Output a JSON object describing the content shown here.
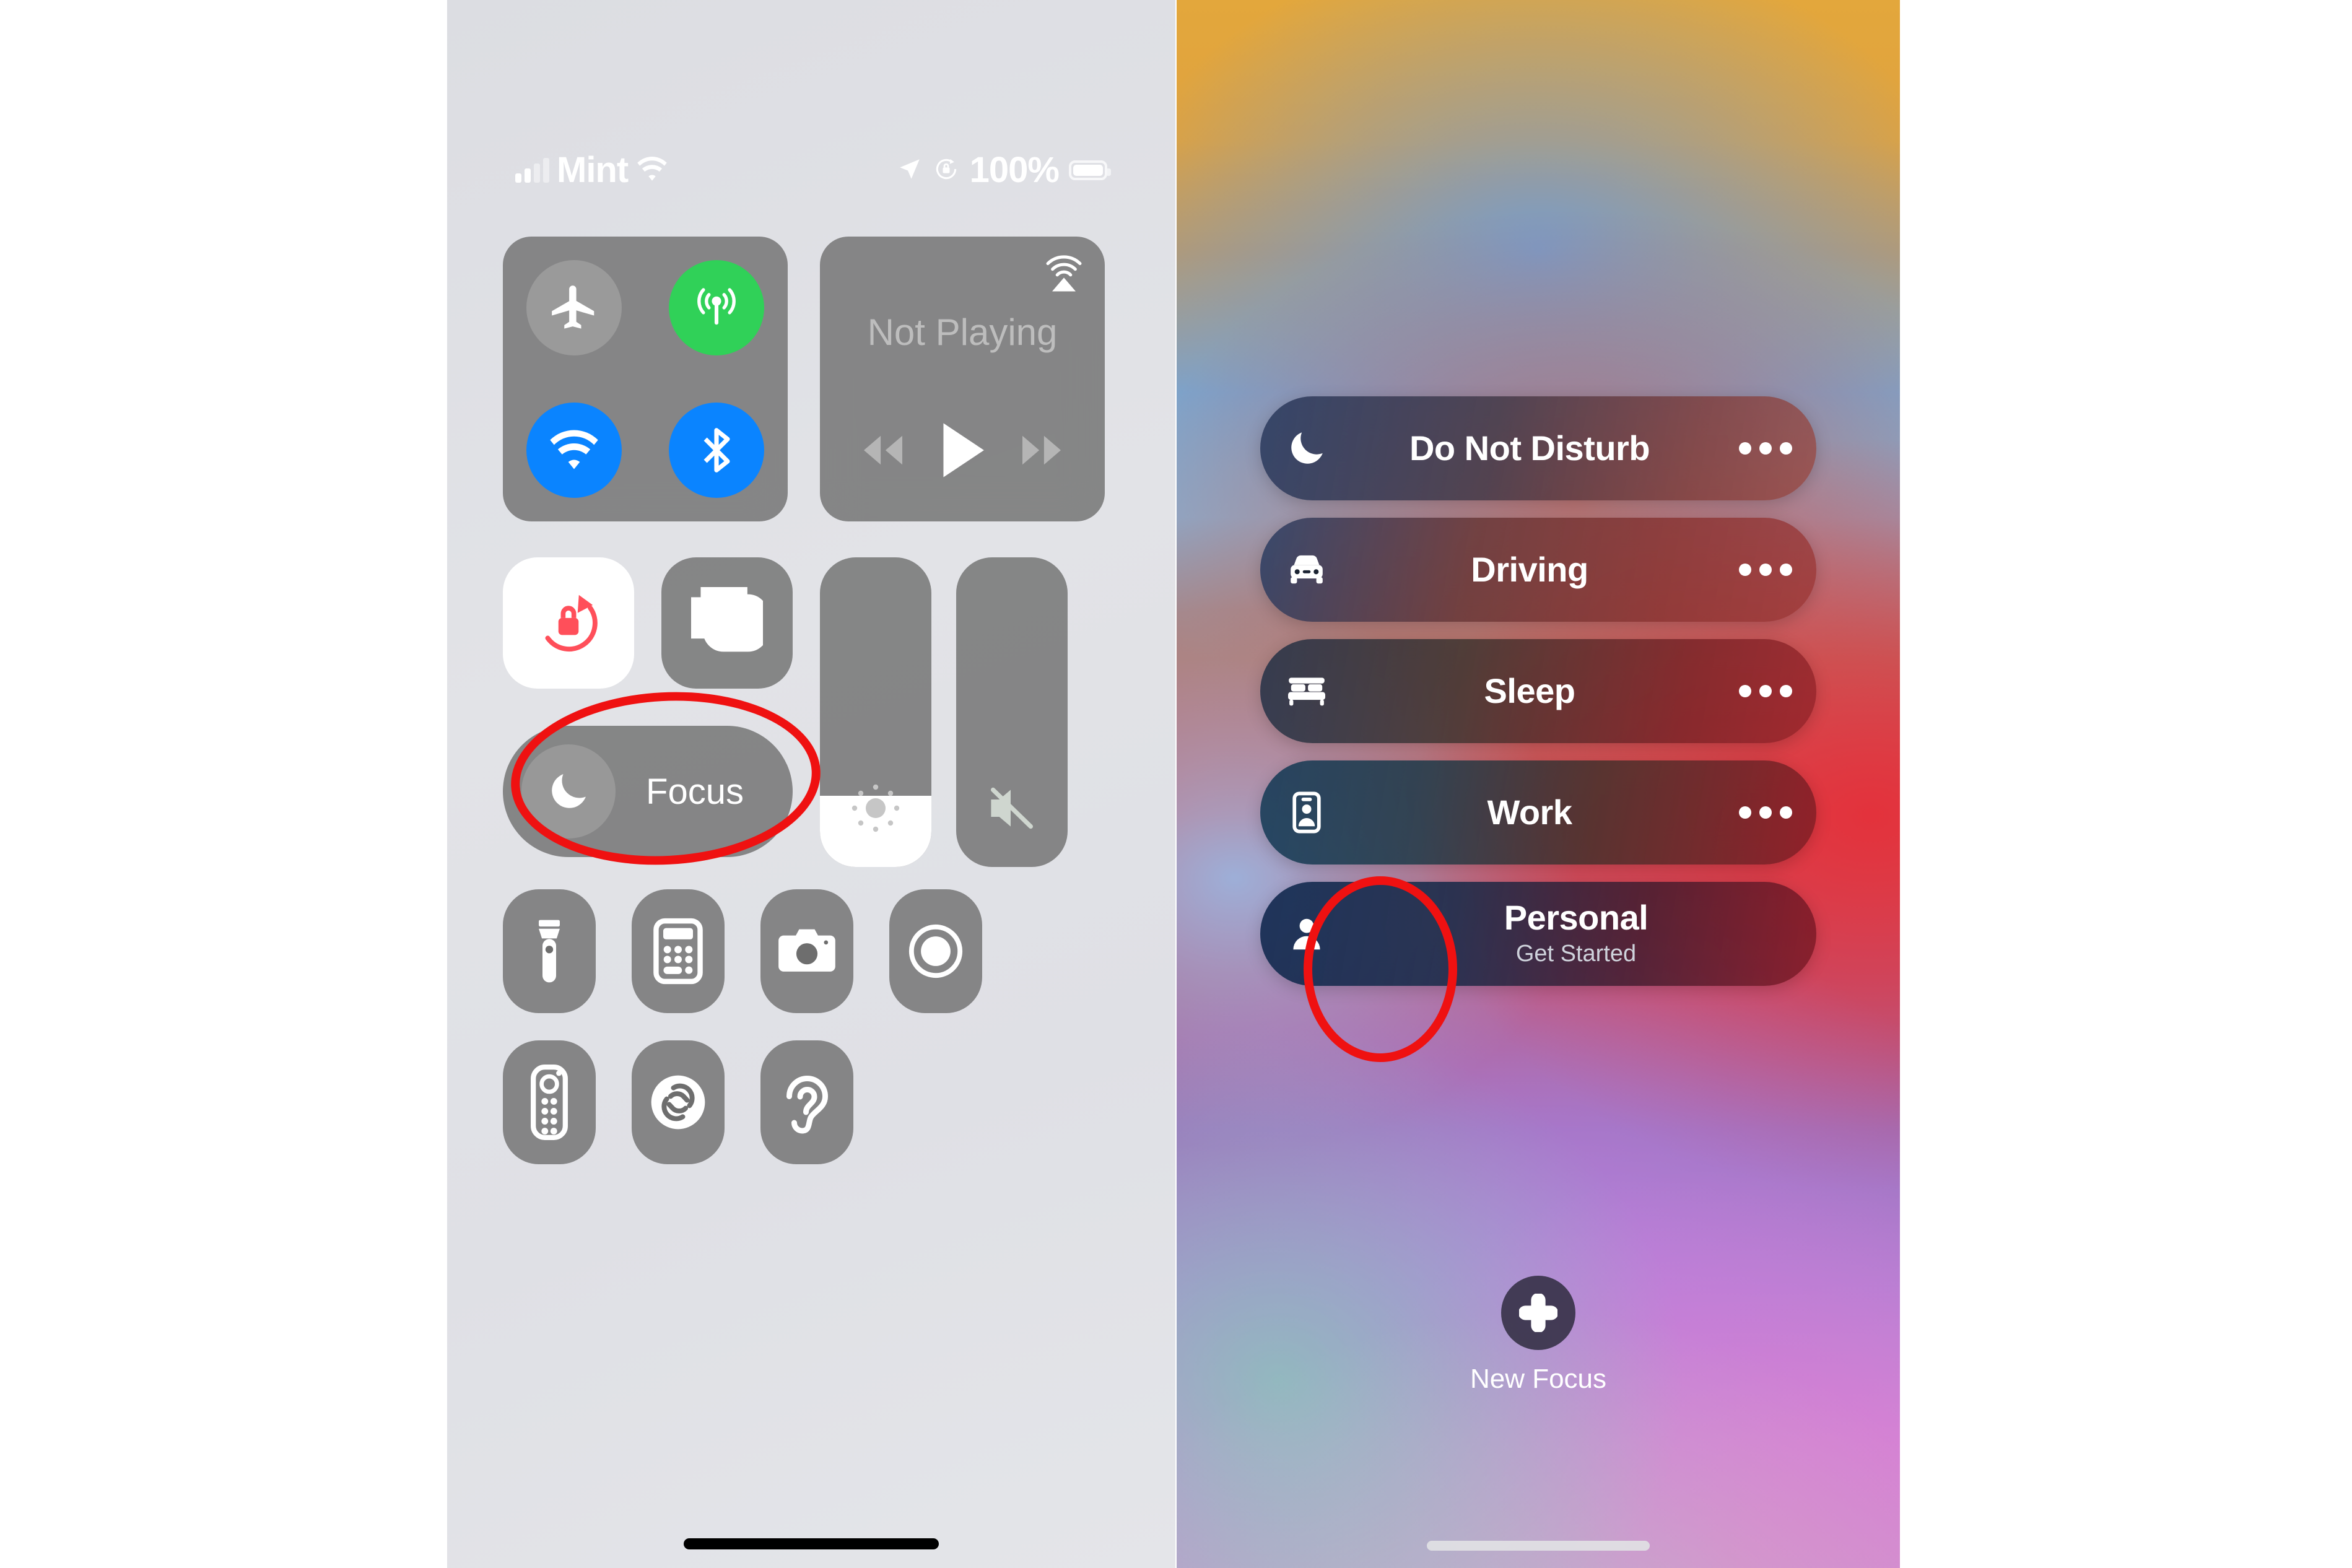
{
  "left_panel": {
    "status_bar": {
      "carrier": "Mint",
      "signal_icon": "cellular-bars-icon",
      "wifi_icon": "wifi-icon",
      "location_icon": "location-arrow-icon",
      "rotation_lock_icon": "rotation-lock-icon",
      "battery_percent": "100%",
      "battery_icon": "battery-full-icon"
    },
    "connectivity": {
      "airplane": {
        "name": "airplane-mode",
        "state": "off",
        "color": "#9a9a9a"
      },
      "cellular": {
        "name": "cellular-data",
        "state": "on",
        "color": "#30d158"
      },
      "wifi": {
        "name": "wifi",
        "state": "on",
        "color": "#0a84ff"
      },
      "bluetooth": {
        "name": "bluetooth",
        "state": "on",
        "color": "#0a84ff"
      }
    },
    "media": {
      "title": "Not Playing",
      "airplay_icon": "airplay-audio-icon",
      "rewind_label": "rewind",
      "play_label": "play",
      "forward_label": "fast-forward"
    },
    "rotation_lock": {
      "label": "rotation-lock",
      "state": "on",
      "color": "#ff4f5a"
    },
    "screen_mirroring": {
      "label": "screen-mirroring"
    },
    "brightness": {
      "label": "brightness",
      "value_percent": 23
    },
    "volume": {
      "label": "volume",
      "value_percent": 0,
      "muted": true
    },
    "focus_button": {
      "label": "Focus",
      "icon": "moon-icon"
    },
    "shortcuts": [
      {
        "name": "flashlight"
      },
      {
        "name": "calculator"
      },
      {
        "name": "camera"
      },
      {
        "name": "screen-record"
      },
      {
        "name": "apple-tv-remote"
      },
      {
        "name": "shazam"
      },
      {
        "name": "hearing"
      }
    ],
    "home_indicator": "home-indicator"
  },
  "right_panel": {
    "focus_modes": [
      {
        "id": "dnd",
        "title": "Do Not Disturb",
        "subtitle": "",
        "icon": "moon-icon",
        "has_more": true
      },
      {
        "id": "driving",
        "title": "Driving",
        "subtitle": "",
        "icon": "car-icon",
        "has_more": true
      },
      {
        "id": "sleep",
        "title": "Sleep",
        "subtitle": "",
        "icon": "bed-icon",
        "has_more": true
      },
      {
        "id": "work",
        "title": "Work",
        "subtitle": "",
        "icon": "id-badge-icon",
        "has_more": true,
        "highlighted": true
      },
      {
        "id": "personal",
        "title": "Personal",
        "subtitle": "Get Started",
        "icon": "person-icon",
        "has_more": false
      }
    ],
    "new_focus": {
      "label": "New Focus",
      "icon": "plus-icon"
    },
    "home_indicator": "home-indicator"
  },
  "annotations": {
    "highlight_color": "#ef1111",
    "items": [
      {
        "name": "focus-button-highlight",
        "target": "Focus"
      },
      {
        "name": "work-more-button-highlight",
        "target": "Work"
      }
    ]
  }
}
